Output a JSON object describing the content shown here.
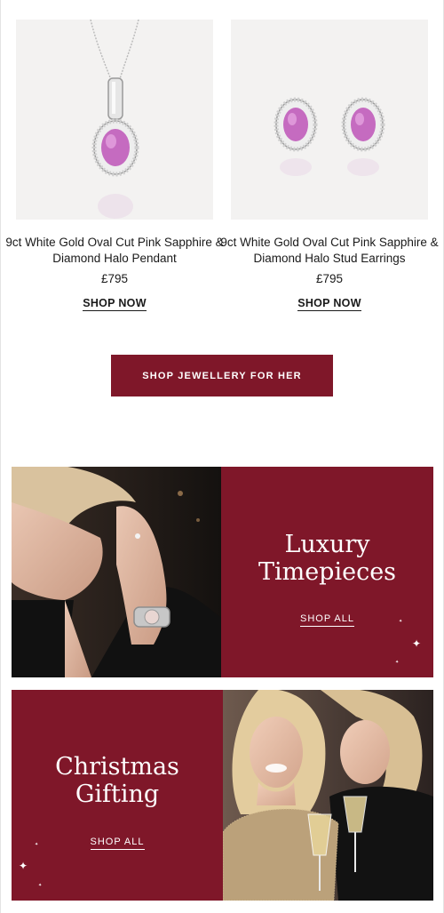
{
  "products": [
    {
      "name": "9ct White Gold Oval Cut Pink Sapphire & Diamond Halo Pendant",
      "price": "£795",
      "link": "SHOP NOW"
    },
    {
      "name": "9ct White Gold Oval Cut Pink Sapphire & Diamond Halo Stud Earrings",
      "price": "£795",
      "link": "SHOP NOW"
    }
  ],
  "cta": {
    "label": "SHOP JEWELLERY FOR HER"
  },
  "banners": [
    {
      "title": "Luxury Timepieces",
      "link": "SHOP ALL"
    },
    {
      "title": "Christmas Gifting",
      "link": "SHOP ALL"
    }
  ],
  "colors": {
    "brand": "#7f1729",
    "card_bg": "#f3f2f1",
    "gem": "#c56bc0"
  }
}
